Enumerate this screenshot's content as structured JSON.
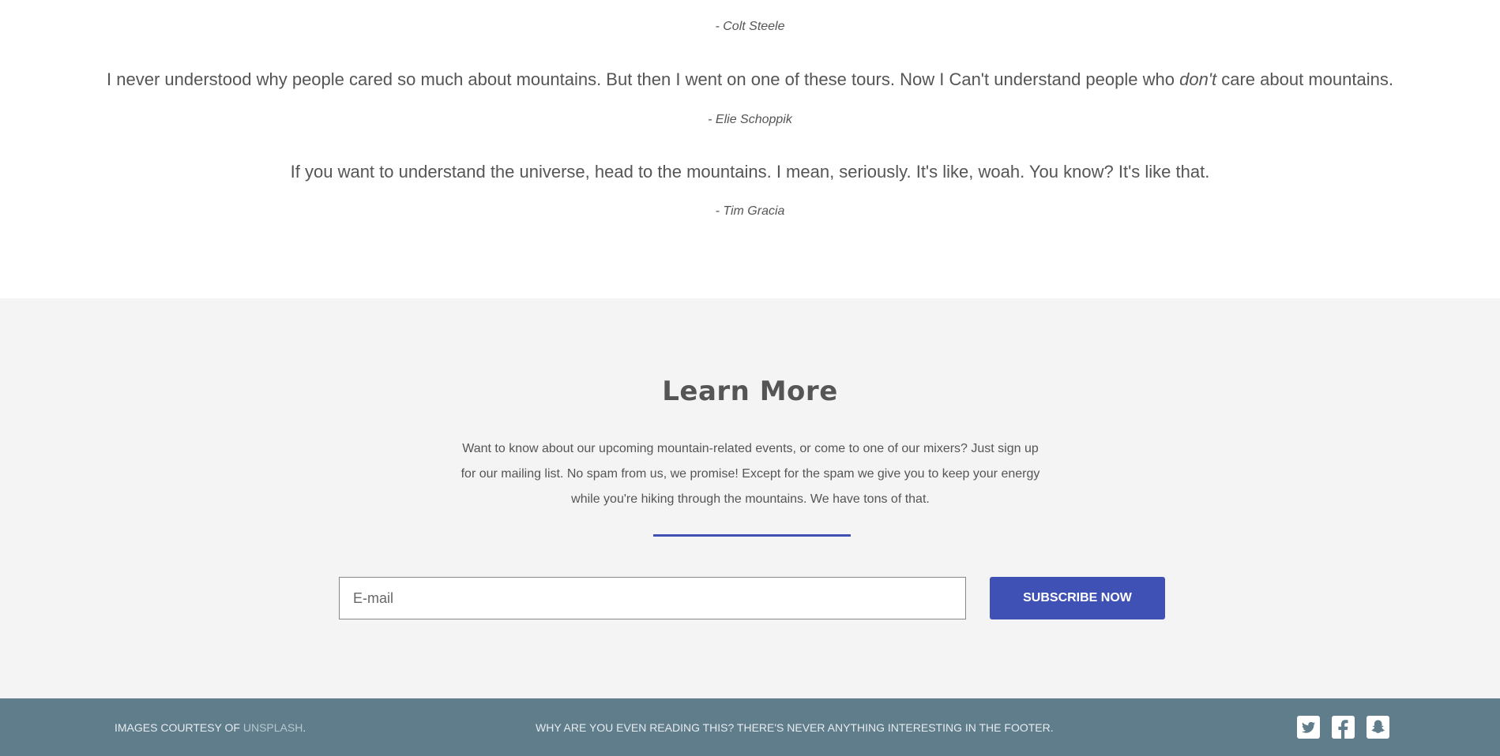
{
  "testimonials": {
    "first_author": "- Colt Steele",
    "quote2": {
      "before": "I never understood why people cared so much about mountains. But then I went on one of these tours. Now I Can't understand people who",
      "emphasis": "don't",
      "after": "care about mountains."
    },
    "author2": "- Elie Schoppik",
    "quote3": "If you want to understand the universe, head to the mountains. I mean, seriously. It's like, woah. You know? It's like that.",
    "author3": "- Tim Gracia"
  },
  "learn_more": {
    "title": "Learn More",
    "description": "Want to know about our upcoming mountain-related events, or come to one of our mixers? Just sign up for our mailing list. No spam from us, we promise! Except for the spam we give you to keep your energy while you're hiking through the mountains. We have tons of that.",
    "email_placeholder": "E-mail",
    "email_value": "",
    "subscribe_label": "SUBSCRIBE NOW",
    "accent_color": "#3f51b5"
  },
  "footer": {
    "credit_prefix": "IMAGES COURTESY OF",
    "credit_link": "UNSPLASH",
    "credit_suffix": ".",
    "tagline": "WHY ARE YOU EVEN READING THIS? THERE'S NEVER ANYTHING INTERESTING IN THE FOOTER.",
    "background_color": "#607d8b",
    "social_icons": [
      "twitter-icon",
      "facebook-icon",
      "snapchat-icon"
    ]
  }
}
